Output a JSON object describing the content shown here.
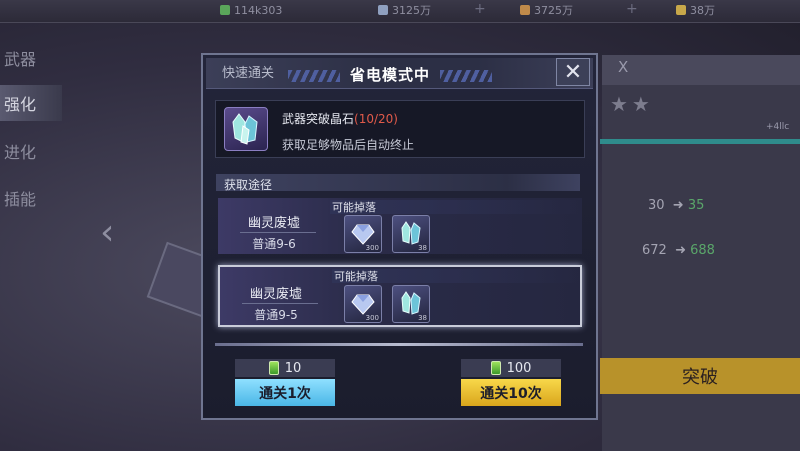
{
  "background": {
    "resources": [
      {
        "value": "114k303",
        "color": "#5aa65a"
      },
      {
        "value": "3125万",
        "color": "#8fa0c0"
      },
      {
        "value": "3725万",
        "color": "#c08a4a"
      },
      {
        "value": "38万",
        "color": "#c8a84a"
      }
    ],
    "side_tabs": [
      "武器",
      "强化",
      "进化",
      "插能"
    ],
    "active_tab": "强化",
    "header_fragment": "X",
    "stat_rows": [
      {
        "from": "30",
        "to": "35"
      },
      {
        "from": "672",
        "to": "688"
      }
    ],
    "break_button": "突破",
    "level_label": "+4llc"
  },
  "modal": {
    "quick_clear_label": "快速通关",
    "title": "省电模式中",
    "close_icon": "close-icon",
    "item": {
      "name": "武器突破晶石",
      "count": "(10/20)",
      "desc": "获取足够物品后自动终止"
    },
    "section_label": "获取途径",
    "routes": [
      {
        "name": "幽灵废墟",
        "stage": "普通9-6",
        "drop_label": "可能掉落",
        "drops": [
          {
            "icon": "gem-icon",
            "qty": "300"
          },
          {
            "icon": "crystal-icon",
            "qty": "38"
          }
        ],
        "selected": false
      },
      {
        "name": "幽灵废墟",
        "stage": "普通9-5",
        "drop_label": "可能掉落",
        "drops": [
          {
            "icon": "gem-icon",
            "qty": "300"
          },
          {
            "icon": "crystal-icon",
            "qty": "38"
          }
        ],
        "selected": true
      }
    ],
    "actions": [
      {
        "cost": "10",
        "label": "通关1次",
        "style": "blue"
      },
      {
        "cost": "100",
        "label": "通关10次",
        "style": "gold"
      }
    ]
  }
}
